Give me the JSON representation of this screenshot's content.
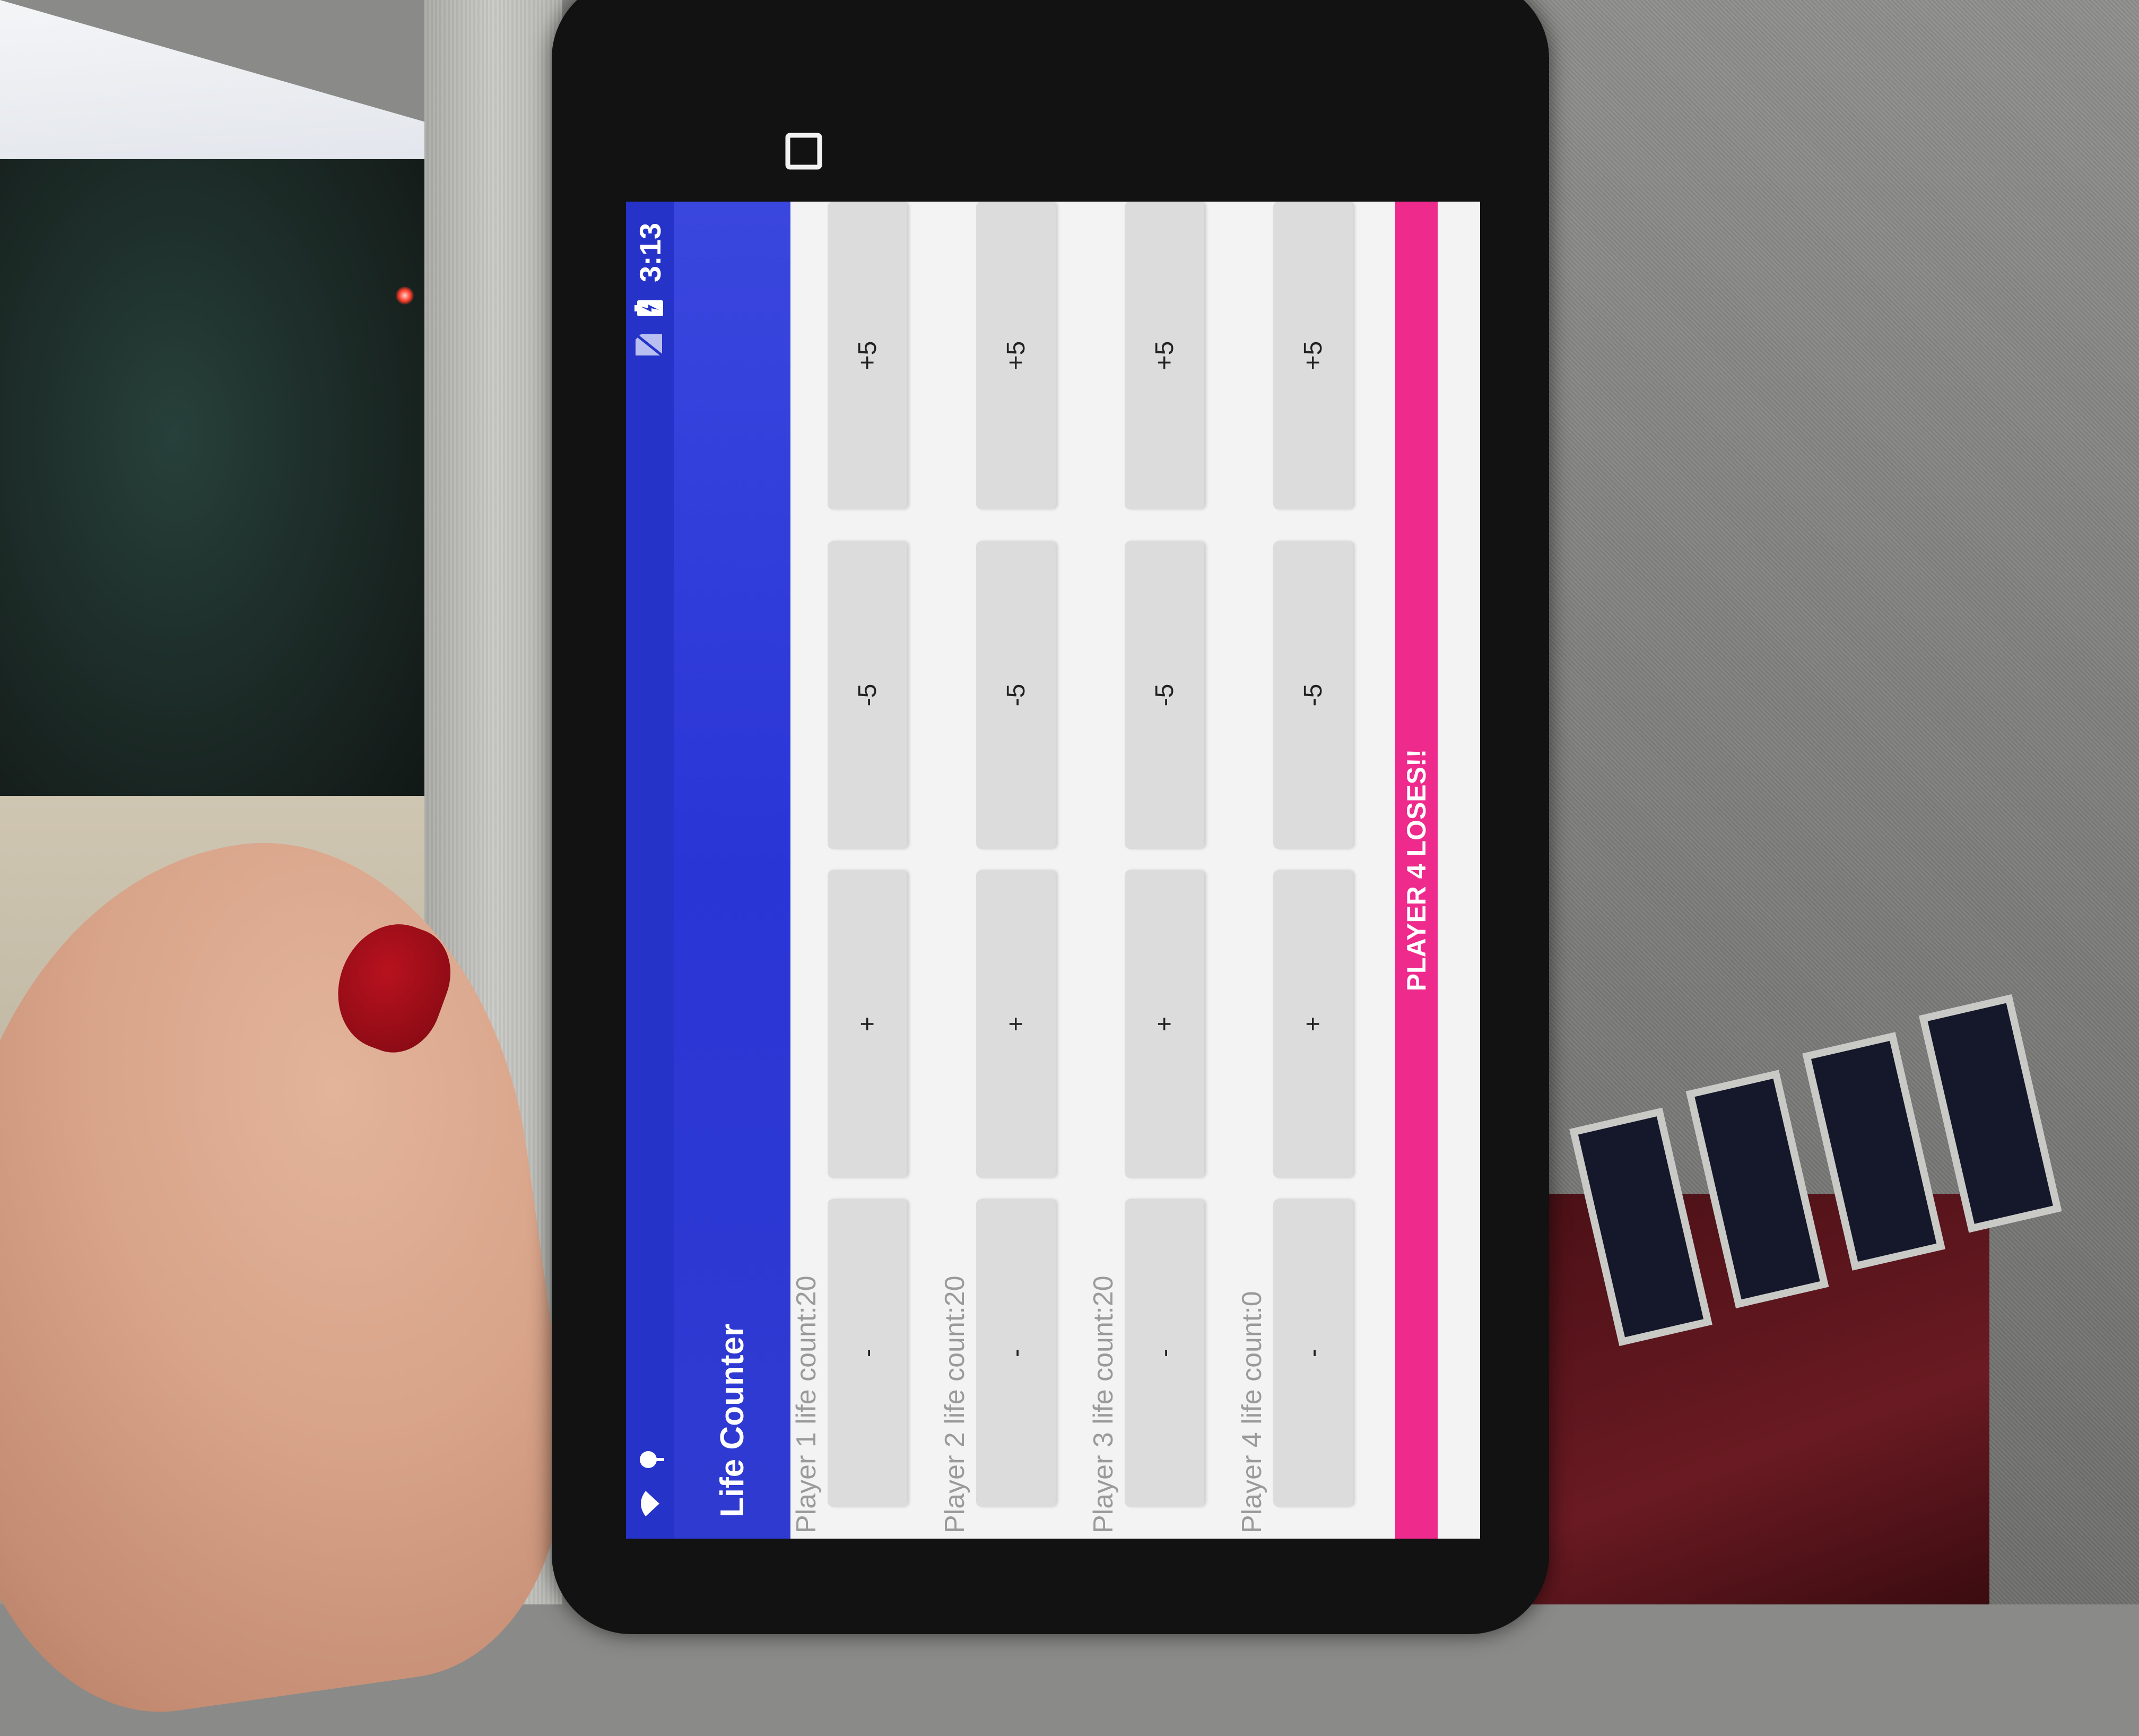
{
  "status_bar": {
    "time": "3:13"
  },
  "action_bar": {
    "title": "Life Counter"
  },
  "players": [
    {
      "label": "Player 1 life count:20",
      "buttons": [
        "-",
        "+",
        "-5",
        "+5"
      ]
    },
    {
      "label": "Player 2 life count:20",
      "buttons": [
        "-",
        "+",
        "-5",
        "+5"
      ]
    },
    {
      "label": "Player 3 life count:20",
      "buttons": [
        "-",
        "+",
        "-5",
        "+5"
      ]
    },
    {
      "label": "Player 4 life count:0",
      "buttons": [
        "-",
        "+",
        "-5",
        "+5"
      ]
    }
  ],
  "result_banner": "PLAYER 4 LOSES!!",
  "nav_bar": {
    "icons": [
      "recents-icon",
      "home-icon",
      "back-icon"
    ]
  },
  "colors": {
    "primary": "#2633c8",
    "accent": "#ee2a8c",
    "button": "#dcdcdc"
  }
}
